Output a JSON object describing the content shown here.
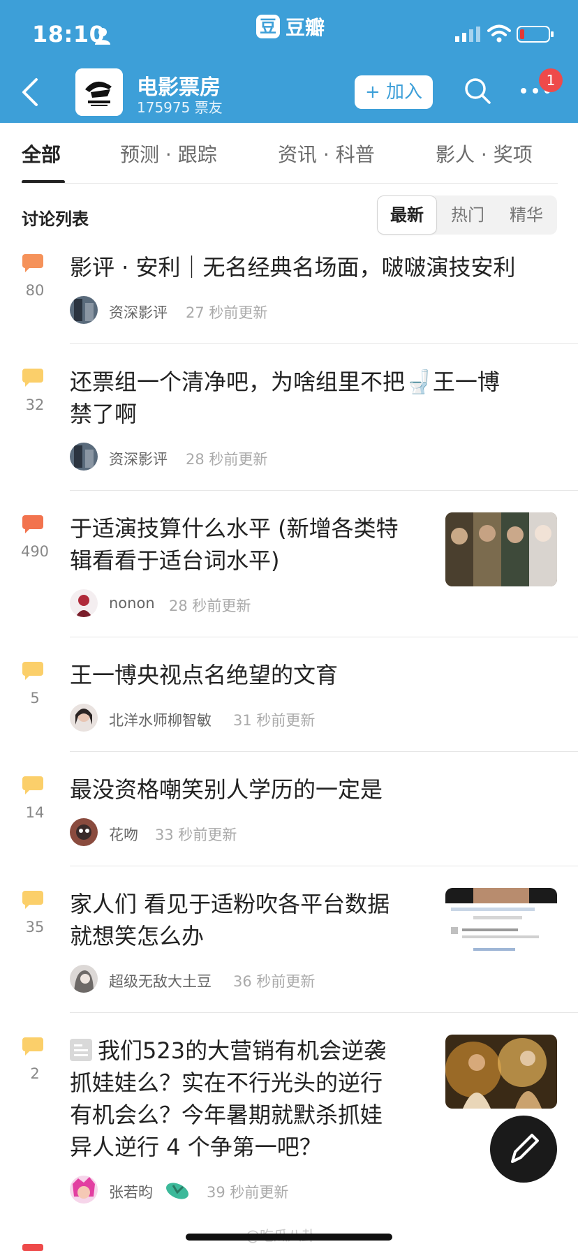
{
  "status": {
    "time": "18:10"
  },
  "app": {
    "logo_text": "豆瓣",
    "logo_mark": "豆"
  },
  "group": {
    "name": "电影票房",
    "members": "175975 票友",
    "join_label": "+ 加入",
    "notification_count": "1"
  },
  "tabs": [
    "全部",
    "预测 · 跟踪",
    "资讯 · 科普",
    "影人 · 奖项"
  ],
  "list": {
    "title": "讨论列表",
    "sort_options": [
      "最新",
      "热门",
      "精华"
    ]
  },
  "posts": [
    {
      "count": "80",
      "title_lines": [
        "影评 · 安利｜无名经典名场面，啵啵演技安利"
      ],
      "author": "资深影评",
      "time": "27 秒前更新",
      "bubble_color": "#f5925a"
    },
    {
      "count": "32",
      "title_lines": [
        "还票组一个清净吧，为啥组里不把🚽王一博",
        "禁了啊"
      ],
      "author": "资深影评",
      "time": "28 秒前更新",
      "bubble_color": "#fbcf6a"
    },
    {
      "count": "490",
      "title_lines": [
        "于适演技算什么水平 (新增各类特",
        "辑看看于适台词水平)"
      ],
      "author": "nonon",
      "time": "28 秒前更新",
      "bubble_color": "#f2734e"
    },
    {
      "count": "5",
      "title_lines": [
        "王一博央视点名绝望的文育"
      ],
      "author": "北洋水师柳智敏",
      "time": "31 秒前更新",
      "bubble_color": "#fbcf6a"
    },
    {
      "count": "14",
      "title_lines": [
        "最没资格嘲笑别人学历的一定是"
      ],
      "author": "花吻",
      "time": "33 秒前更新",
      "bubble_color": "#fbcf6a"
    },
    {
      "count": "35",
      "title_lines": [
        "家人们 看见于适粉吹各平台数据",
        "就想笑怎么办"
      ],
      "author": "超级无敌大土豆",
      "time": "36 秒前更新",
      "bubble_color": "#fbcf6a"
    },
    {
      "count": "2",
      "title_lines": [
        "我们523的大营销有机会逆袭",
        "抓娃娃么？实在不行光头的逆行",
        "有机会么？今年暑期就默杀抓娃",
        "异人逆行 4 个争第一吧？"
      ],
      "author": "张若昀",
      "time": "39 秒前更新",
      "bubble_color": "#fbcf6a"
    }
  ],
  "watermark": "@吃瓜八卦..."
}
